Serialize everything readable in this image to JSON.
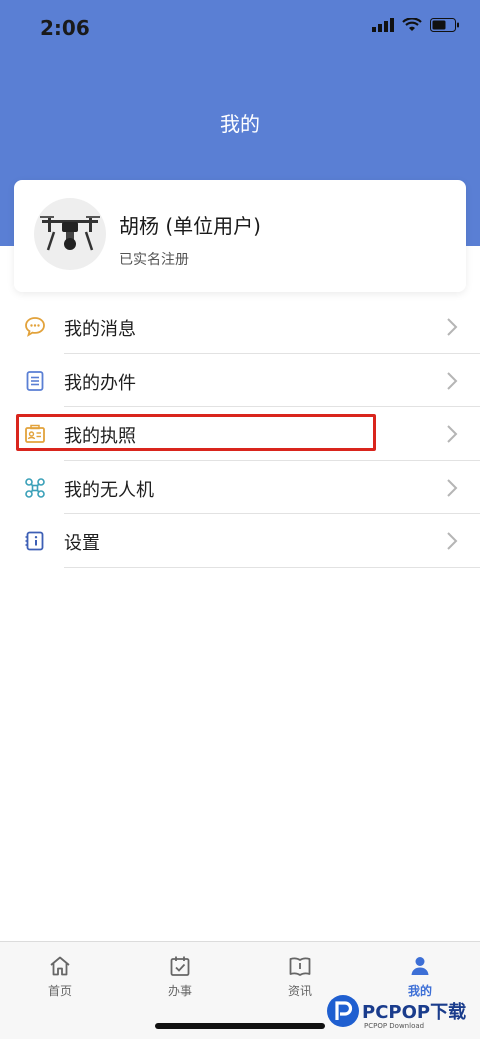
{
  "status_bar": {
    "time": "2:06"
  },
  "header": {
    "title": "我的"
  },
  "profile": {
    "name": "胡杨 (单位用户)",
    "status": "已实名注册"
  },
  "menu": {
    "items": [
      {
        "label": "我的消息",
        "icon": "chat-bubble-icon",
        "color": "#e2a23b"
      },
      {
        "label": "我的办件",
        "icon": "document-list-icon",
        "color": "#5a7fd4"
      },
      {
        "label": "我的执照",
        "icon": "license-card-icon",
        "color": "#e2a23b"
      },
      {
        "label": "我的无人机",
        "icon": "drone-icon",
        "color": "#3aa0b8"
      },
      {
        "label": "设置",
        "icon": "settings-info-icon",
        "color": "#3d5fb5"
      }
    ]
  },
  "tabs": [
    {
      "label": "首页",
      "icon": "home-icon"
    },
    {
      "label": "办事",
      "icon": "calendar-check-icon"
    },
    {
      "label": "资讯",
      "icon": "book-info-icon"
    },
    {
      "label": "我的",
      "icon": "user-icon",
      "active": true
    }
  ],
  "watermark": {
    "brand": "PCPOP下载",
    "sub": "PCPOP Download"
  },
  "colors": {
    "header": "#5a7fd4",
    "accent": "#3d6fd6",
    "highlight": "#d9251d"
  }
}
